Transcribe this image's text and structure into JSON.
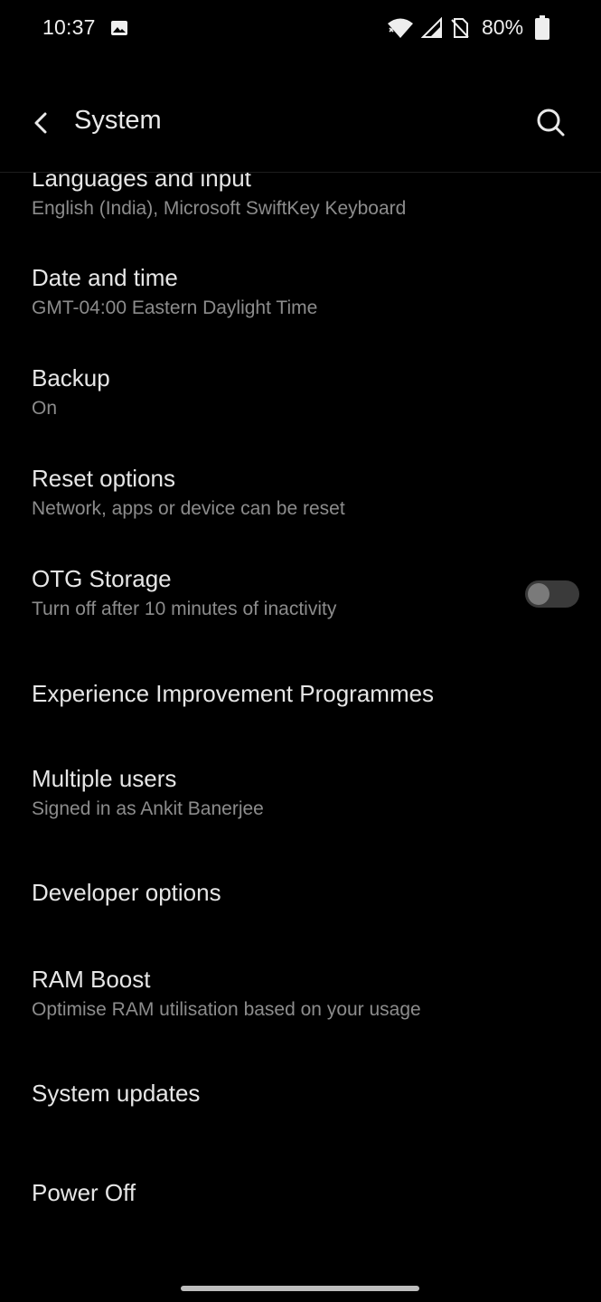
{
  "status": {
    "time": "10:37",
    "battery_percent": "80%",
    "icons": [
      "gallery-icon",
      "wifi-icon",
      "signal-icon",
      "no-sim-icon",
      "battery-icon"
    ]
  },
  "appbar": {
    "title": "System",
    "back_icon": "back-arrow-icon",
    "search_icon": "search-icon"
  },
  "items": [
    {
      "title": "Languages and input",
      "subtitle": "English (India), Microsoft SwiftKey Keyboard"
    },
    {
      "title": "Date and time",
      "subtitle": "GMT-04:00 Eastern Daylight Time"
    },
    {
      "title": "Backup",
      "subtitle": "On"
    },
    {
      "title": "Reset options",
      "subtitle": "Network, apps or device can be reset"
    },
    {
      "title": "OTG Storage",
      "subtitle": "Turn off after 10 minutes of inactivity",
      "toggle_on": false
    },
    {
      "title": "Experience Improvement Programmes",
      "subtitle": ""
    },
    {
      "title": "Multiple users",
      "subtitle": "Signed in as Ankit Banerjee"
    },
    {
      "title": "Developer options",
      "subtitle": ""
    },
    {
      "title": "RAM Boost",
      "subtitle": "Optimise RAM utilisation based on your usage"
    },
    {
      "title": "System updates",
      "subtitle": ""
    },
    {
      "title": "Power Off",
      "subtitle": ""
    }
  ],
  "colors": {
    "background": "#000000",
    "title_text": "#e6e6e6",
    "subtitle_text": "#8c8c8c",
    "toggle_off_track": "#3a3a3a",
    "toggle_off_knob": "#7a7a7a"
  }
}
